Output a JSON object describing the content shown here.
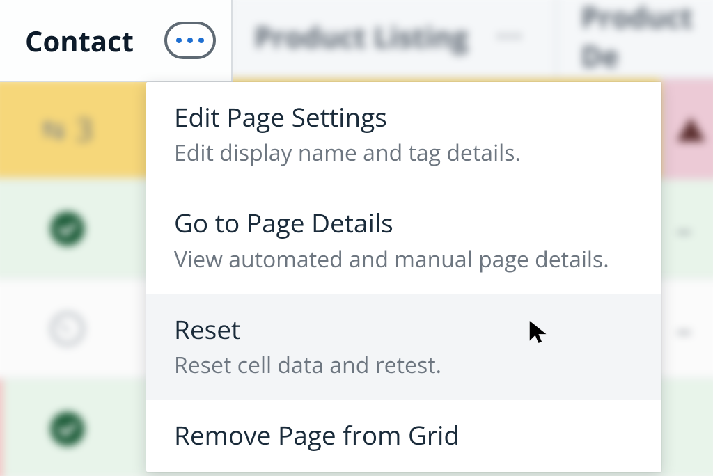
{
  "header": {
    "tabs": [
      {
        "label": "Contact"
      },
      {
        "label": "Product Listing"
      },
      {
        "label": "Product De"
      }
    ]
  },
  "grid": {
    "row0_count": "3",
    "dash": "–"
  },
  "menu": {
    "items": [
      {
        "title": "Edit Page Settings",
        "desc": "Edit display name and tag details."
      },
      {
        "title": "Go to Page Details",
        "desc": "View automated and manual page details."
      },
      {
        "title": "Reset",
        "desc": "Reset cell data and retest."
      },
      {
        "title": "Remove Page from Grid",
        "desc": ""
      }
    ]
  }
}
